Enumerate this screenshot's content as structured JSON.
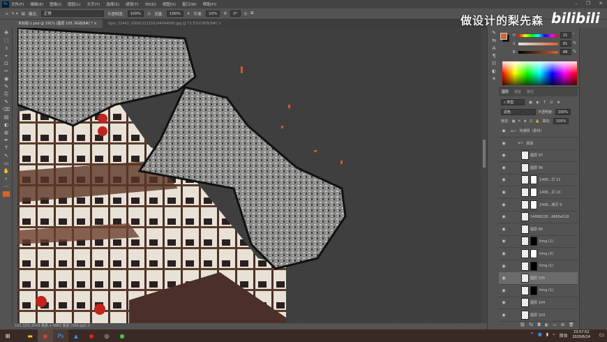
{
  "app": {
    "logo": "Ps"
  },
  "menu": [
    "文件(F)",
    "编辑(E)",
    "图像(I)",
    "图层(L)",
    "文字(Y)",
    "选择(S)",
    "滤镜(T)",
    "3D(D)",
    "视图(V)",
    "窗口(W)",
    "帮助(H)"
  ],
  "window_controls": [
    "–",
    "❐",
    "✕"
  ],
  "options": {
    "mode_label": "模式:",
    "mode_value": "正常",
    "opacity_label": "不透明度:",
    "opacity_value": "100%",
    "flow_label": "流量:",
    "flow_value": "100%",
    "smooth_label": "平滑:",
    "smooth_value": "10%",
    "angle_value": "0°"
  },
  "tabs": [
    {
      "label": "未标题-1.psd @ 191% (图层 105, RGB/8#) *",
      "active": true
    },
    {
      "label": "hjpic_22443_20091221150144044095.jpg @ 71.5%(CMYK/8#)",
      "active": false
    }
  ],
  "status": {
    "text": "191.32%   2543 像素 x 4961 像素 (300 ppi)   >"
  },
  "watermark": {
    "text": "做设计的梨先森",
    "logo": "bilibili"
  },
  "color": {
    "fg": "#e0602a",
    "bg": "#111111",
    "h_label": "H",
    "h_value": "21",
    "s_label": "S",
    "s_value": "81",
    "b_label": "B",
    "b_value": "88",
    "unit_deg": "°",
    "unit_pct": "%"
  },
  "layers_panel": {
    "tabs": [
      "图层",
      "通道",
      "路径"
    ],
    "filter_label": "类型",
    "blend_mode": "滤色",
    "opacity_label": "不透明度:",
    "opacity_value": "100%",
    "lock_label": "锁定:",
    "fill_label": "填充:",
    "fill_value": "100%",
    "layers": [
      {
        "name": "沟通网（素材）",
        "type": "group",
        "selected": false
      },
      {
        "name": "损毁",
        "type": "group",
        "selected": false
      },
      {
        "name": "图层 97",
        "type": "layer",
        "selected": false
      },
      {
        "name": "图层 96",
        "type": "layer",
        "selected": false
      },
      {
        "name": "1406...贝 11",
        "type": "masked",
        "mask": "white",
        "selected": false
      },
      {
        "name": "1406...贝 10",
        "type": "masked",
        "mask": "white",
        "selected": false
      },
      {
        "name": "1406...拷贝 9",
        "type": "masked",
        "mask": "white",
        "selected": false
      },
      {
        "name": "14068228...d665e518",
        "type": "layer",
        "selected": false
      },
      {
        "name": "图层 66",
        "type": "layer",
        "selected": false
      },
      {
        "name": "timg (1)",
        "type": "masked",
        "mask": "black",
        "selected": false
      },
      {
        "name": "timg (3)",
        "type": "masked",
        "mask": "white",
        "selected": false
      },
      {
        "name": "timg (1)",
        "type": "masked",
        "mask": "black",
        "selected": false
      },
      {
        "name": "图层 105",
        "type": "layer",
        "selected": true
      },
      {
        "name": "timg (1)",
        "type": "masked",
        "mask": "black",
        "selected": false
      },
      {
        "name": "图层 104",
        "type": "layer",
        "selected": false
      },
      {
        "name": "图层 103",
        "type": "layer",
        "selected": false
      }
    ],
    "footer_icons": [
      "link-icon",
      "fx-icon",
      "mask-icon",
      "adjustment-icon",
      "folder-icon",
      "new-layer-icon",
      "trash-icon"
    ]
  },
  "taskbar": {
    "time": "23:57:52",
    "date": "2020/6/14",
    "ime": "简体"
  }
}
